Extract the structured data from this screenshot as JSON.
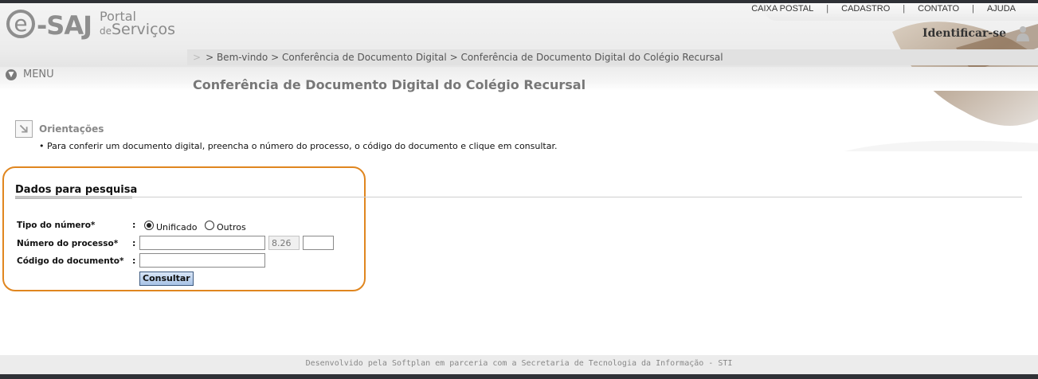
{
  "header": {
    "logo_main": "e-SAJ",
    "logo_portal": "Portal",
    "logo_de": "de",
    "logo_servicos": "Serviços",
    "top_links": [
      "CAIXA POSTAL",
      "CADASTRO",
      "CONTATO",
      "AJUDA"
    ],
    "separator": "|",
    "identify_label": "Identificar-se",
    "user_icon": "user-icon"
  },
  "breadcrumb": {
    "items": [
      "Bem-vindo",
      "Conferência de Documento Digital",
      "Conferência de Documento Digital do Colégio Recursal"
    ],
    "separator": ">"
  },
  "menu": {
    "label": "MENU",
    "icon": "chevron-down-icon"
  },
  "page": {
    "title": "Conferência de Documento Digital do Colégio Recursal"
  },
  "orientacoes": {
    "title": "Orientações",
    "text": "• Para conferir um documento digital, preencha o número do processo, o código do documento e clique em consultar."
  },
  "form": {
    "section_title": "Dados para pesquisa",
    "colon": ":",
    "tipo_label": "Tipo do número*",
    "radio_unificado": "Unificado",
    "radio_outros": "Outros",
    "selected": "Unificado",
    "processo_label": "Número do processo*",
    "processo_value": "",
    "processo_fixed": "8.26",
    "processo_foro": "",
    "codigo_label": "Código do documento*",
    "codigo_value": "",
    "submit_label": "Consultar"
  },
  "footer": {
    "text": "Desenvolvido pela Softplan em parceria com a Secretaria de Tecnologia da Informação - STI"
  },
  "colors": {
    "accent_border": "#e0861f",
    "button_top": "#d9e6f7",
    "button_bottom": "#a8c3e6"
  }
}
